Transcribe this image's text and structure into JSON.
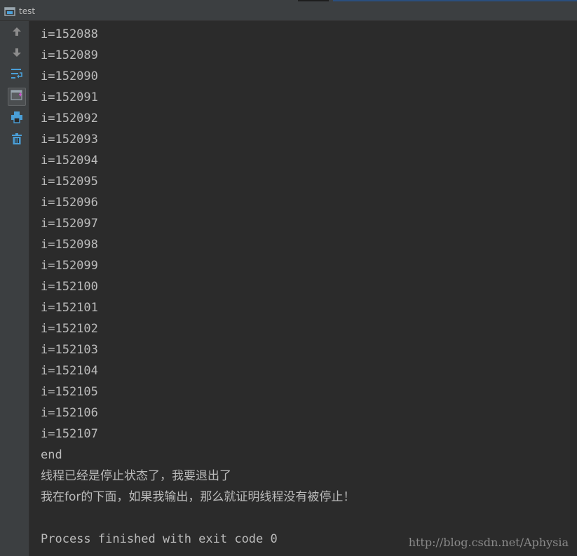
{
  "window": {
    "title": "test"
  },
  "toolbar": {
    "buttons": [
      {
        "icon": "arrow-up-icon"
      },
      {
        "icon": "arrow-down-icon"
      },
      {
        "icon": "soft-wrap-icon"
      },
      {
        "icon": "scroll-to-end-icon",
        "active": true
      },
      {
        "icon": "print-icon"
      },
      {
        "icon": "trash-icon"
      }
    ]
  },
  "console": {
    "lines": [
      "i=152088",
      "i=152089",
      "i=152090",
      "i=152091",
      "i=152092",
      "i=152093",
      "i=152094",
      "i=152095",
      "i=152096",
      "i=152097",
      "i=152098",
      "i=152099",
      "i=152100",
      "i=152101",
      "i=152102",
      "i=152103",
      "i=152104",
      "i=152105",
      "i=152106",
      "i=152107",
      "end",
      "线程已经是停止状态了，我要退出了",
      "我在for的下面，如果我输出，那么就证明线程没有被停止！",
      "",
      "Process finished with exit code 0"
    ]
  },
  "watermark": "http://blog.csdn.net/Aphysia",
  "colors": {
    "background": "#2b2b2b",
    "panel": "#3c3f41",
    "text": "#bbbbbb",
    "icon_blue": "#4a9fd8",
    "icon_gray": "#8c8c8c",
    "icon_pink": "#d14fd1"
  }
}
